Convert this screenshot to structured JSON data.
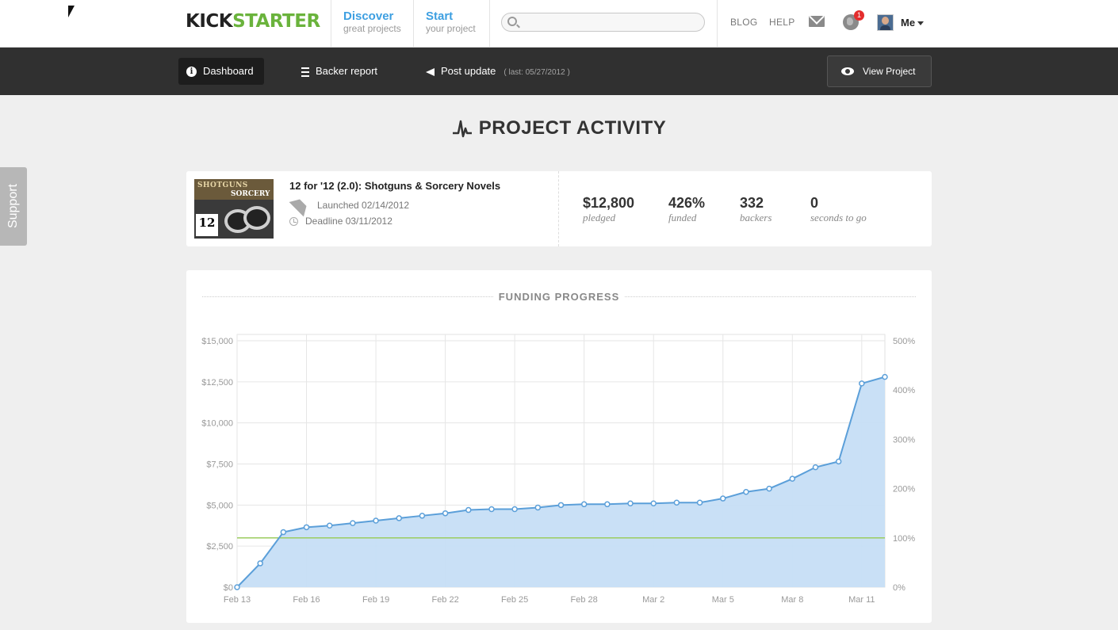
{
  "nav": {
    "logo_kick": "KICK",
    "logo_starter": "STARTER",
    "discover": {
      "title": "Discover",
      "subtitle": "great projects"
    },
    "start": {
      "title": "Start",
      "subtitle": "your project"
    },
    "search_placeholder": "",
    "blog": "BLOG",
    "help": "HELP",
    "notification_count": "1",
    "user": "Me"
  },
  "dashbar": {
    "dashboard": "Dashboard",
    "backer_report": "Backer report",
    "post_update": "Post update",
    "last_update": "( last: 05/27/2012 )",
    "view_project": "View Project"
  },
  "support": "Support",
  "heading": "PROJECT ACTIVITY",
  "project": {
    "title": "12 for '12 (2.0): Shotguns & Sorcery Novels",
    "launched": "Launched 02/14/2012",
    "deadline": "Deadline 03/11/2012",
    "thumb_text_1": "SHOTGUNS",
    "thumb_text_2": "SORCERY",
    "thumb_number": "12",
    "stats": [
      {
        "value": "$12,800",
        "label": "pledged"
      },
      {
        "value": "426%",
        "label": "funded"
      },
      {
        "value": "332",
        "label": "backers"
      },
      {
        "value": "0",
        "label": "seconds to go"
      }
    ]
  },
  "chart_panel_title": "FUNDING PROGRESS",
  "colors": {
    "brand_green": "#6ab33c",
    "link_blue": "#3d9fe1",
    "chart_line": "#5b9fd9",
    "chart_fill": "#c6def6",
    "goal_line": "#9ccc5f"
  },
  "chart_data": {
    "type": "area",
    "title": "FUNDING PROGRESS",
    "x_ticks": [
      "Feb 13",
      "Feb 16",
      "Feb 19",
      "Feb 22",
      "Feb 25",
      "Feb 28",
      "Mar 2",
      "Mar 5",
      "Mar 8",
      "Mar 11"
    ],
    "y_ticks_left": [
      "$0",
      "$2,500",
      "$5,000",
      "$7,500",
      "$10,000",
      "$12,500",
      "$15,000"
    ],
    "y_ticks_right": [
      "0%",
      "100%",
      "200%",
      "300%",
      "400%",
      "500%"
    ],
    "ylim": [
      0,
      15000
    ],
    "goal": 3000,
    "grid": true,
    "series": [
      {
        "values": [
          0,
          1450,
          3350,
          3650,
          3750,
          3900,
          4050,
          4200,
          4350,
          4500,
          4700,
          4750,
          4750,
          4850,
          5000,
          5050,
          5050,
          5100,
          5100,
          5150,
          5150,
          5400,
          5800,
          6000,
          6600,
          7300,
          7650,
          12400,
          12800
        ]
      }
    ]
  }
}
